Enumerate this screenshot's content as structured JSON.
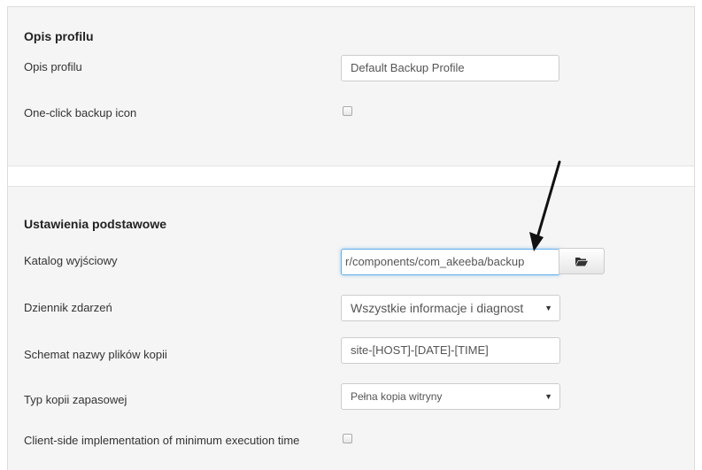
{
  "section_profile": {
    "title": "Opis profilu",
    "description_label": "Opis profilu",
    "description_value": "Default Backup Profile",
    "oneclick_label": "One-click backup icon",
    "oneclick_checked": false
  },
  "section_basic": {
    "title": "Ustawienia podstawowe",
    "output_dir_label": "Katalog wyjściowy",
    "output_dir_value": "r/components/com_akeeba/backup",
    "log_label": "Dziennik zdarzeń",
    "log_value": "Wszystkie informacje i diagnost",
    "naming_label": "Schemat nazwy plików kopii",
    "naming_value": "site-[HOST]-[DATE]-[TIME]",
    "type_label": "Typ kopii zapasowej",
    "type_value": "Pełna kopia witryny",
    "client_side_label": "Client-side implementation of minimum execution time",
    "client_side_checked": false
  },
  "icons": {
    "browse": "folder-open-icon",
    "dropdown": "caret-down-icon",
    "annotation": "arrow-annotation-icon"
  },
  "colors": {
    "panel_bg": "#f5f5f5",
    "focus_border": "#66afe9"
  }
}
